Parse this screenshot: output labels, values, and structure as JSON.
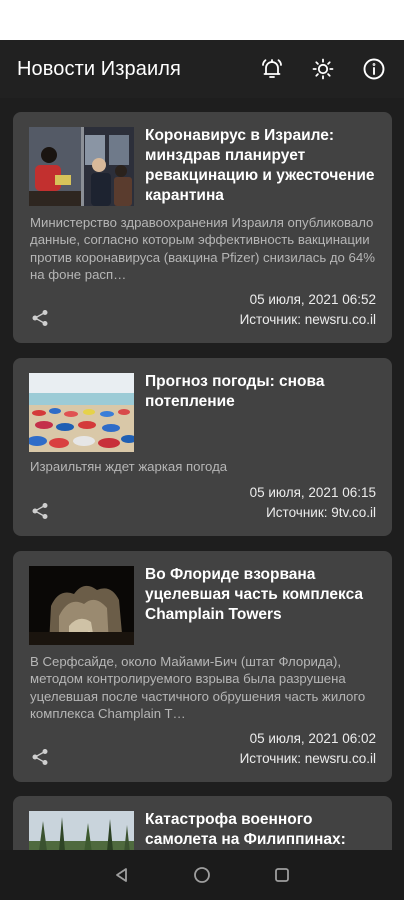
{
  "app_bar": {
    "title": "Новости Израиля",
    "icons": [
      "bell-alert-icon",
      "brightness-icon",
      "info-icon"
    ]
  },
  "articles": [
    {
      "title": "Коронавирус в Израиле: минздрав планирует ревакцинацию и ужесточение карантина",
      "summary": "Министерство здравоохранения Израиля опубликовало данные, согласно которым эффективность вакцинации против коронавируса (вакцина Pfizer) снизилась до 64% на фоне расп…",
      "date": "05 июля, 2021 06:52",
      "source": "Источник: newsru.co.il"
    },
    {
      "title": "Прогноз погоды: снова потепление",
      "summary": "Израильтян ждет жаркая погода",
      "date": "05 июля, 2021 06:15",
      "source": "Источник: 9tv.co.il"
    },
    {
      "title": "Во Флориде взорвана уцелевшая часть комплекса Champlain Towers",
      "summary": "В Серфсайде, около Майами-Бич (штат Флорида), методом контролируемого взрыва была разрушена уцелевшая после частичного обрушения часть жилого комплекса Champlain T…",
      "date": "05 июля, 2021 06:02",
      "source": "Источник: newsru.co.il"
    },
    {
      "title": "Катастрофа военного самолета на Филиппинах:"
    }
  ],
  "colors": {
    "background": "#1e1e1e",
    "app_bar": "#212121",
    "card": "#424242",
    "summary_text": "#b6b6b6"
  }
}
